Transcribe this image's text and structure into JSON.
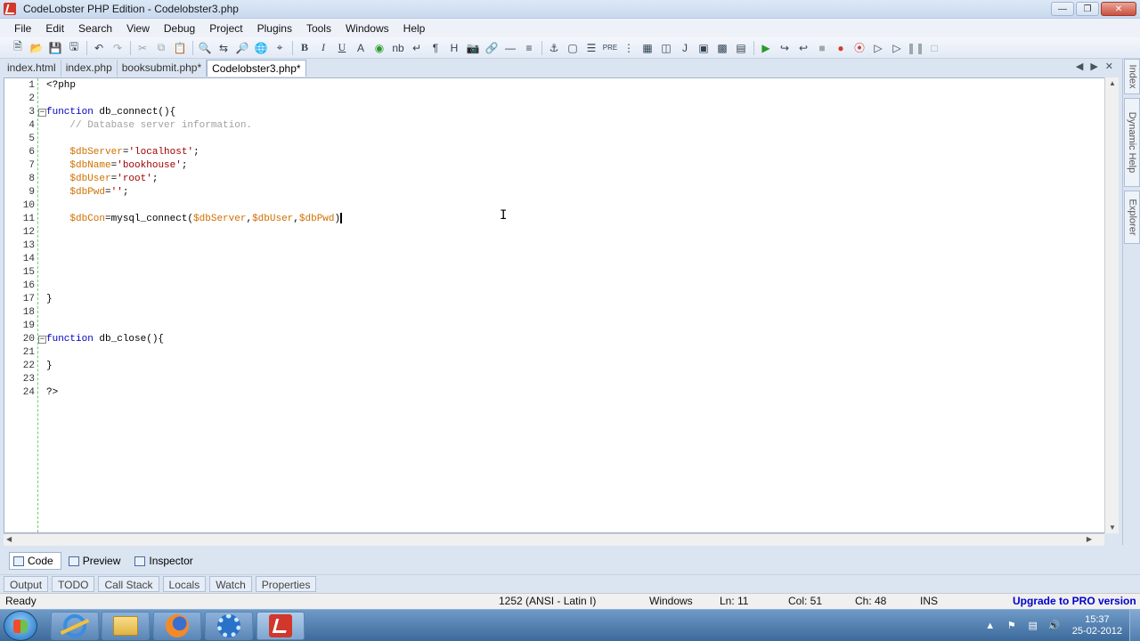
{
  "window": {
    "title": "CodeLobster PHP Edition - Codelobster3.php",
    "controls": [
      "minimize",
      "maximize",
      "close"
    ]
  },
  "menu": [
    {
      "label": "File",
      "accel": "F"
    },
    {
      "label": "Edit",
      "accel": "E"
    },
    {
      "label": "Search",
      "accel": "S"
    },
    {
      "label": "View",
      "accel": "V"
    },
    {
      "label": "Debug",
      "accel": "D"
    },
    {
      "label": "Project",
      "accel": "P"
    },
    {
      "label": "Plugins",
      "accel": "l"
    },
    {
      "label": "Tools",
      "accel": "T"
    },
    {
      "label": "Windows",
      "accel": "W"
    },
    {
      "label": "Help",
      "accel": "H"
    }
  ],
  "toolbar": {
    "bold": "B",
    "italic": "I",
    "underline": "U",
    "font": "A",
    "nb": "nb",
    "para": "¶",
    "heading": "H",
    "pre": "PRE",
    "j": "J"
  },
  "tabs": [
    {
      "label": "index.html",
      "active": false
    },
    {
      "label": "index.php",
      "active": false
    },
    {
      "label": "booksubmit.php*",
      "active": false
    },
    {
      "label": "Codelobster3.php*",
      "active": true
    }
  ],
  "editor": {
    "lines": [
      {
        "n": "1"
      },
      {
        "n": "2"
      },
      {
        "n": "3"
      },
      {
        "n": "4"
      },
      {
        "n": "5"
      },
      {
        "n": "6"
      },
      {
        "n": "7"
      },
      {
        "n": "8"
      },
      {
        "n": "9"
      },
      {
        "n": "10"
      },
      {
        "n": "11"
      },
      {
        "n": "12"
      },
      {
        "n": "13"
      },
      {
        "n": "14"
      },
      {
        "n": "15"
      },
      {
        "n": "16"
      },
      {
        "n": "17"
      },
      {
        "n": "18"
      },
      {
        "n": "19"
      },
      {
        "n": "20"
      },
      {
        "n": "21"
      },
      {
        "n": "22"
      },
      {
        "n": "23"
      },
      {
        "n": "24"
      }
    ],
    "code": {
      "l1": "<?php",
      "l3_kw": "function",
      "l3_rest": " db_connect(){",
      "l4": "    // Database server information.",
      "l6_var": "    $dbServer",
      "l6_eq": "=",
      "l6_str": "'localhost'",
      "l6_end": ";",
      "l7_var": "    $dbName",
      "l7_eq": "=",
      "l7_str": "'bookhouse'",
      "l7_end": ";",
      "l8_var": "    $dbUser",
      "l8_eq": "=",
      "l8_str": "'root'",
      "l8_end": ";",
      "l9_var": "    $dbPwd",
      "l9_eq": "=",
      "l9_str": "''",
      "l9_end": ";",
      "l11_var1": "    $dbCon",
      "l11_mid": "=mysql_connect(",
      "l11_var2": "$dbServer",
      "l11_c1": ",",
      "l11_var3": "$dbUser",
      "l11_c2": ",",
      "l11_var4": "$dbPwd",
      "l11_end": ")",
      "l17": "}",
      "l20_kw": "function",
      "l20_rest": " db_close(){",
      "l22": "}",
      "l24": "?>"
    }
  },
  "side_panels": [
    "Index",
    "Dynamic Help",
    "Explorer"
  ],
  "view_tabs": [
    {
      "label": "Code",
      "active": true
    },
    {
      "label": "Preview",
      "active": false
    },
    {
      "label": "Inspector",
      "active": false
    }
  ],
  "output_tabs": [
    "Output",
    "TODO",
    "Call Stack",
    "Locals",
    "Watch",
    "Properties"
  ],
  "status": {
    "ready": "Ready",
    "encoding": "1252  (ANSI - Latin I)",
    "eol": "Windows",
    "line": "Ln: 11",
    "col": "Col: 51",
    "ch": "Ch: 48",
    "mode": "INS",
    "upgrade": "Upgrade to PRO version"
  },
  "taskbar": {
    "time": "15:37",
    "date": "25-02-2012",
    "apps": [
      "internet-explorer",
      "windows-explorer",
      "firefox",
      "settings",
      "codelobster"
    ]
  }
}
